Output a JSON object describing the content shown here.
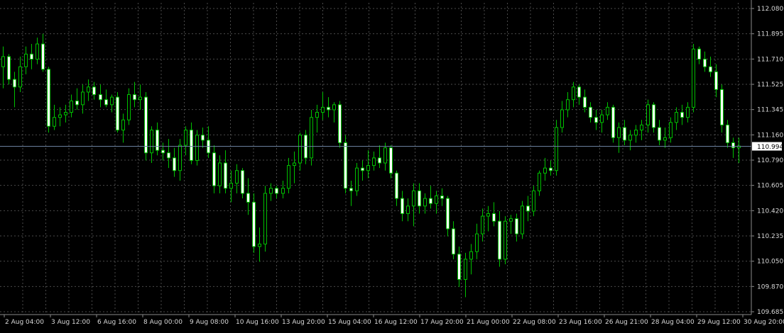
{
  "chart_data": {
    "type": "candlestick",
    "x_tick_labels": [
      "2 Aug 04:00",
      "3 Aug 12:00",
      "6 Aug 16:00",
      "8 Aug 00:00",
      "9 Aug 08:00",
      "10 Aug 16:00",
      "13 Aug 20:00",
      "15 Aug 04:00",
      "16 Aug 12:00",
      "17 Aug 20:00",
      "21 Aug 00:00",
      "22 Aug 08:00",
      "23 Aug 16:00",
      "26 Aug 21:00",
      "28 Aug 04:00",
      "29 Aug 12:00",
      "30 Aug 20:00"
    ],
    "y_tick_labels": [
      "112.080",
      "111.895",
      "111.710",
      "111.525",
      "111.345",
      "111.160",
      "110.790",
      "110.605",
      "110.420",
      "110.235",
      "110.050",
      "109.870",
      "109.685"
    ],
    "ylim": [
      109.685,
      112.08
    ],
    "current_price": 110.994,
    "current_price_label": "110.994",
    "grid": true,
    "colors": {
      "background": "#000000",
      "grid": "#4a4a4a",
      "candle": "#00c000",
      "bear_body": "#ffffff",
      "price_line": "#6a7f9c",
      "price_label_bg": "#ffffff",
      "text": "#d8d8d8"
    },
    "candles": [
      {
        "o": 111.62,
        "h": 111.78,
        "l": 111.45,
        "c": 111.7
      },
      {
        "o": 111.7,
        "h": 111.72,
        "l": 111.48,
        "c": 111.52
      },
      {
        "o": 111.52,
        "h": 111.58,
        "l": 111.3,
        "c": 111.46
      },
      {
        "o": 111.46,
        "h": 111.7,
        "l": 111.42,
        "c": 111.62
      },
      {
        "o": 111.62,
        "h": 111.78,
        "l": 111.56,
        "c": 111.72
      },
      {
        "o": 111.72,
        "h": 111.8,
        "l": 111.6,
        "c": 111.68
      },
      {
        "o": 111.68,
        "h": 111.85,
        "l": 111.64,
        "c": 111.8
      },
      {
        "o": 111.8,
        "h": 111.88,
        "l": 111.58,
        "c": 111.6
      },
      {
        "o": 111.6,
        "h": 111.62,
        "l": 111.1,
        "c": 111.15
      },
      {
        "o": 111.15,
        "h": 111.32,
        "l": 111.12,
        "c": 111.22
      },
      {
        "o": 111.22,
        "h": 111.3,
        "l": 111.15,
        "c": 111.24
      },
      {
        "o": 111.24,
        "h": 111.32,
        "l": 111.18,
        "c": 111.26
      },
      {
        "o": 111.26,
        "h": 111.4,
        "l": 111.22,
        "c": 111.35
      },
      {
        "o": 111.35,
        "h": 111.45,
        "l": 111.28,
        "c": 111.32
      },
      {
        "o": 111.32,
        "h": 111.48,
        "l": 111.25,
        "c": 111.42
      },
      {
        "o": 111.42,
        "h": 111.52,
        "l": 111.35,
        "c": 111.46
      },
      {
        "o": 111.46,
        "h": 111.5,
        "l": 111.36,
        "c": 111.4
      },
      {
        "o": 111.4,
        "h": 111.48,
        "l": 111.3,
        "c": 111.36
      },
      {
        "o": 111.36,
        "h": 111.44,
        "l": 111.3,
        "c": 111.32
      },
      {
        "o": 111.32,
        "h": 111.4,
        "l": 111.26,
        "c": 111.38
      },
      {
        "o": 111.38,
        "h": 111.42,
        "l": 111.1,
        "c": 111.12
      },
      {
        "o": 111.12,
        "h": 111.25,
        "l": 111.02,
        "c": 111.2
      },
      {
        "o": 111.2,
        "h": 111.45,
        "l": 111.16,
        "c": 111.4
      },
      {
        "o": 111.4,
        "h": 111.5,
        "l": 111.3,
        "c": 111.36
      },
      {
        "o": 111.36,
        "h": 111.48,
        "l": 111.28,
        "c": 111.38
      },
      {
        "o": 111.38,
        "h": 111.42,
        "l": 110.88,
        "c": 110.94
      },
      {
        "o": 110.94,
        "h": 111.15,
        "l": 110.86,
        "c": 111.12
      },
      {
        "o": 111.12,
        "h": 111.18,
        "l": 110.92,
        "c": 110.96
      },
      {
        "o": 110.96,
        "h": 111.02,
        "l": 110.88,
        "c": 110.94
      },
      {
        "o": 110.94,
        "h": 111.05,
        "l": 110.82,
        "c": 110.9
      },
      {
        "o": 110.9,
        "h": 110.98,
        "l": 110.75,
        "c": 110.8
      },
      {
        "o": 110.8,
        "h": 111.05,
        "l": 110.72,
        "c": 111.0
      },
      {
        "o": 111.0,
        "h": 111.15,
        "l": 110.92,
        "c": 111.12
      },
      {
        "o": 111.12,
        "h": 111.18,
        "l": 110.85,
        "c": 110.88
      },
      {
        "o": 110.88,
        "h": 111.12,
        "l": 110.84,
        "c": 111.08
      },
      {
        "o": 111.08,
        "h": 111.14,
        "l": 110.98,
        "c": 111.04
      },
      {
        "o": 111.04,
        "h": 111.15,
        "l": 110.9,
        "c": 110.94
      },
      {
        "o": 110.94,
        "h": 111.0,
        "l": 110.62,
        "c": 110.68
      },
      {
        "o": 110.68,
        "h": 110.92,
        "l": 110.62,
        "c": 110.86
      },
      {
        "o": 110.86,
        "h": 110.96,
        "l": 110.62,
        "c": 110.66
      },
      {
        "o": 110.66,
        "h": 110.8,
        "l": 110.55,
        "c": 110.7
      },
      {
        "o": 110.7,
        "h": 110.85,
        "l": 110.62,
        "c": 110.8
      },
      {
        "o": 110.8,
        "h": 110.82,
        "l": 110.58,
        "c": 110.62
      },
      {
        "o": 110.62,
        "h": 110.74,
        "l": 110.45,
        "c": 110.55
      },
      {
        "o": 110.55,
        "h": 110.62,
        "l": 110.15,
        "c": 110.2
      },
      {
        "o": 110.2,
        "h": 110.35,
        "l": 110.08,
        "c": 110.22
      },
      {
        "o": 110.22,
        "h": 110.68,
        "l": 110.16,
        "c": 110.62
      },
      {
        "o": 110.62,
        "h": 110.7,
        "l": 110.56,
        "c": 110.66
      },
      {
        "o": 110.66,
        "h": 110.68,
        "l": 110.58,
        "c": 110.62
      },
      {
        "o": 110.62,
        "h": 110.72,
        "l": 110.58,
        "c": 110.66
      },
      {
        "o": 110.66,
        "h": 110.9,
        "l": 110.62,
        "c": 110.84
      },
      {
        "o": 110.84,
        "h": 110.95,
        "l": 110.7,
        "c": 110.86
      },
      {
        "o": 110.86,
        "h": 111.1,
        "l": 110.8,
        "c": 111.08
      },
      {
        "o": 111.08,
        "h": 111.12,
        "l": 110.85,
        "c": 110.9
      },
      {
        "o": 110.9,
        "h": 111.28,
        "l": 110.84,
        "c": 111.22
      },
      {
        "o": 111.22,
        "h": 111.32,
        "l": 111.1,
        "c": 111.26
      },
      {
        "o": 111.26,
        "h": 111.42,
        "l": 111.2,
        "c": 111.3
      },
      {
        "o": 111.3,
        "h": 111.38,
        "l": 111.22,
        "c": 111.28
      },
      {
        "o": 111.28,
        "h": 111.34,
        "l": 111.18,
        "c": 111.32
      },
      {
        "o": 111.32,
        "h": 111.35,
        "l": 110.98,
        "c": 111.02
      },
      {
        "o": 111.02,
        "h": 111.08,
        "l": 110.62,
        "c": 110.66
      },
      {
        "o": 110.66,
        "h": 110.72,
        "l": 110.52,
        "c": 110.64
      },
      {
        "o": 110.64,
        "h": 110.86,
        "l": 110.6,
        "c": 110.82
      },
      {
        "o": 110.82,
        "h": 110.88,
        "l": 110.72,
        "c": 110.8
      },
      {
        "o": 110.8,
        "h": 110.96,
        "l": 110.74,
        "c": 110.84
      },
      {
        "o": 110.84,
        "h": 110.95,
        "l": 110.8,
        "c": 110.9
      },
      {
        "o": 110.9,
        "h": 111.0,
        "l": 110.82,
        "c": 110.86
      },
      {
        "o": 110.86,
        "h": 111.02,
        "l": 110.8,
        "c": 110.98
      },
      {
        "o": 110.98,
        "h": 111.0,
        "l": 110.74,
        "c": 110.78
      },
      {
        "o": 110.78,
        "h": 110.8,
        "l": 110.52,
        "c": 110.58
      },
      {
        "o": 110.58,
        "h": 110.64,
        "l": 110.4,
        "c": 110.46
      },
      {
        "o": 110.46,
        "h": 110.58,
        "l": 110.4,
        "c": 110.52
      },
      {
        "o": 110.52,
        "h": 110.7,
        "l": 110.36,
        "c": 110.64
      },
      {
        "o": 110.64,
        "h": 110.7,
        "l": 110.46,
        "c": 110.52
      },
      {
        "o": 110.52,
        "h": 110.62,
        "l": 110.46,
        "c": 110.58
      },
      {
        "o": 110.58,
        "h": 110.68,
        "l": 110.5,
        "c": 110.54
      },
      {
        "o": 110.54,
        "h": 110.64,
        "l": 110.46,
        "c": 110.6
      },
      {
        "o": 110.6,
        "h": 110.66,
        "l": 110.52,
        "c": 110.58
      },
      {
        "o": 110.58,
        "h": 110.6,
        "l": 110.28,
        "c": 110.34
      },
      {
        "o": 110.34,
        "h": 110.4,
        "l": 110.1,
        "c": 110.14
      },
      {
        "o": 110.14,
        "h": 110.2,
        "l": 109.88,
        "c": 109.94
      },
      {
        "o": 109.94,
        "h": 110.15,
        "l": 109.8,
        "c": 110.1
      },
      {
        "o": 110.1,
        "h": 110.22,
        "l": 109.98,
        "c": 110.16
      },
      {
        "o": 110.16,
        "h": 110.38,
        "l": 110.1,
        "c": 110.3
      },
      {
        "o": 110.3,
        "h": 110.5,
        "l": 110.24,
        "c": 110.44
      },
      {
        "o": 110.44,
        "h": 110.52,
        "l": 110.32,
        "c": 110.46
      },
      {
        "o": 110.46,
        "h": 110.55,
        "l": 110.36,
        "c": 110.4
      },
      {
        "o": 110.4,
        "h": 110.48,
        "l": 110.04,
        "c": 110.1
      },
      {
        "o": 110.1,
        "h": 110.44,
        "l": 110.06,
        "c": 110.4
      },
      {
        "o": 110.4,
        "h": 110.45,
        "l": 110.3,
        "c": 110.42
      },
      {
        "o": 110.42,
        "h": 110.46,
        "l": 110.24,
        "c": 110.3
      },
      {
        "o": 110.3,
        "h": 110.56,
        "l": 110.26,
        "c": 110.52
      },
      {
        "o": 110.52,
        "h": 110.6,
        "l": 110.4,
        "c": 110.48
      },
      {
        "o": 110.48,
        "h": 110.68,
        "l": 110.44,
        "c": 110.64
      },
      {
        "o": 110.64,
        "h": 110.8,
        "l": 110.6,
        "c": 110.78
      },
      {
        "o": 110.78,
        "h": 110.9,
        "l": 110.72,
        "c": 110.82
      },
      {
        "o": 110.82,
        "h": 110.88,
        "l": 110.76,
        "c": 110.8
      },
      {
        "o": 110.8,
        "h": 111.2,
        "l": 110.76,
        "c": 111.14
      },
      {
        "o": 111.14,
        "h": 111.35,
        "l": 111.1,
        "c": 111.28
      },
      {
        "o": 111.28,
        "h": 111.42,
        "l": 111.22,
        "c": 111.36
      },
      {
        "o": 111.36,
        "h": 111.5,
        "l": 111.3,
        "c": 111.46
      },
      {
        "o": 111.46,
        "h": 111.48,
        "l": 111.32,
        "c": 111.38
      },
      {
        "o": 111.38,
        "h": 111.44,
        "l": 111.26,
        "c": 111.3
      },
      {
        "o": 111.3,
        "h": 111.34,
        "l": 111.18,
        "c": 111.22
      },
      {
        "o": 111.22,
        "h": 111.28,
        "l": 111.12,
        "c": 111.18
      },
      {
        "o": 111.18,
        "h": 111.28,
        "l": 111.1,
        "c": 111.24
      },
      {
        "o": 111.24,
        "h": 111.34,
        "l": 111.2,
        "c": 111.3
      },
      {
        "o": 111.3,
        "h": 111.32,
        "l": 111.02,
        "c": 111.06
      },
      {
        "o": 111.06,
        "h": 111.18,
        "l": 110.94,
        "c": 111.14
      },
      {
        "o": 111.14,
        "h": 111.2,
        "l": 111.0,
        "c": 111.04
      },
      {
        "o": 111.04,
        "h": 111.12,
        "l": 110.96,
        "c": 111.08
      },
      {
        "o": 111.08,
        "h": 111.16,
        "l": 111.02,
        "c": 111.12
      },
      {
        "o": 111.12,
        "h": 111.2,
        "l": 111.04,
        "c": 111.16
      },
      {
        "o": 111.16,
        "h": 111.36,
        "l": 111.1,
        "c": 111.32
      },
      {
        "o": 111.32,
        "h": 111.34,
        "l": 111.1,
        "c": 111.14
      },
      {
        "o": 111.14,
        "h": 111.2,
        "l": 111.0,
        "c": 111.04
      },
      {
        "o": 111.04,
        "h": 111.14,
        "l": 110.98,
        "c": 111.06
      },
      {
        "o": 111.06,
        "h": 111.22,
        "l": 111.02,
        "c": 111.18
      },
      {
        "o": 111.18,
        "h": 111.3,
        "l": 111.12,
        "c": 111.26
      },
      {
        "o": 111.26,
        "h": 111.32,
        "l": 111.16,
        "c": 111.22
      },
      {
        "o": 111.22,
        "h": 111.34,
        "l": 111.18,
        "c": 111.3
      },
      {
        "o": 111.3,
        "h": 111.8,
        "l": 111.26,
        "c": 111.76
      },
      {
        "o": 111.76,
        "h": 111.78,
        "l": 111.64,
        "c": 111.68
      },
      {
        "o": 111.68,
        "h": 111.74,
        "l": 111.58,
        "c": 111.62
      },
      {
        "o": 111.62,
        "h": 111.7,
        "l": 111.54,
        "c": 111.58
      },
      {
        "o": 111.58,
        "h": 111.64,
        "l": 111.38,
        "c": 111.44
      },
      {
        "o": 111.44,
        "h": 111.48,
        "l": 111.1,
        "c": 111.16
      },
      {
        "o": 111.16,
        "h": 111.2,
        "l": 110.98,
        "c": 111.02
      },
      {
        "o": 111.02,
        "h": 111.06,
        "l": 110.9,
        "c": 110.98
      },
      {
        "o": 110.98,
        "h": 111.06,
        "l": 110.86,
        "c": 110.994
      }
    ]
  }
}
